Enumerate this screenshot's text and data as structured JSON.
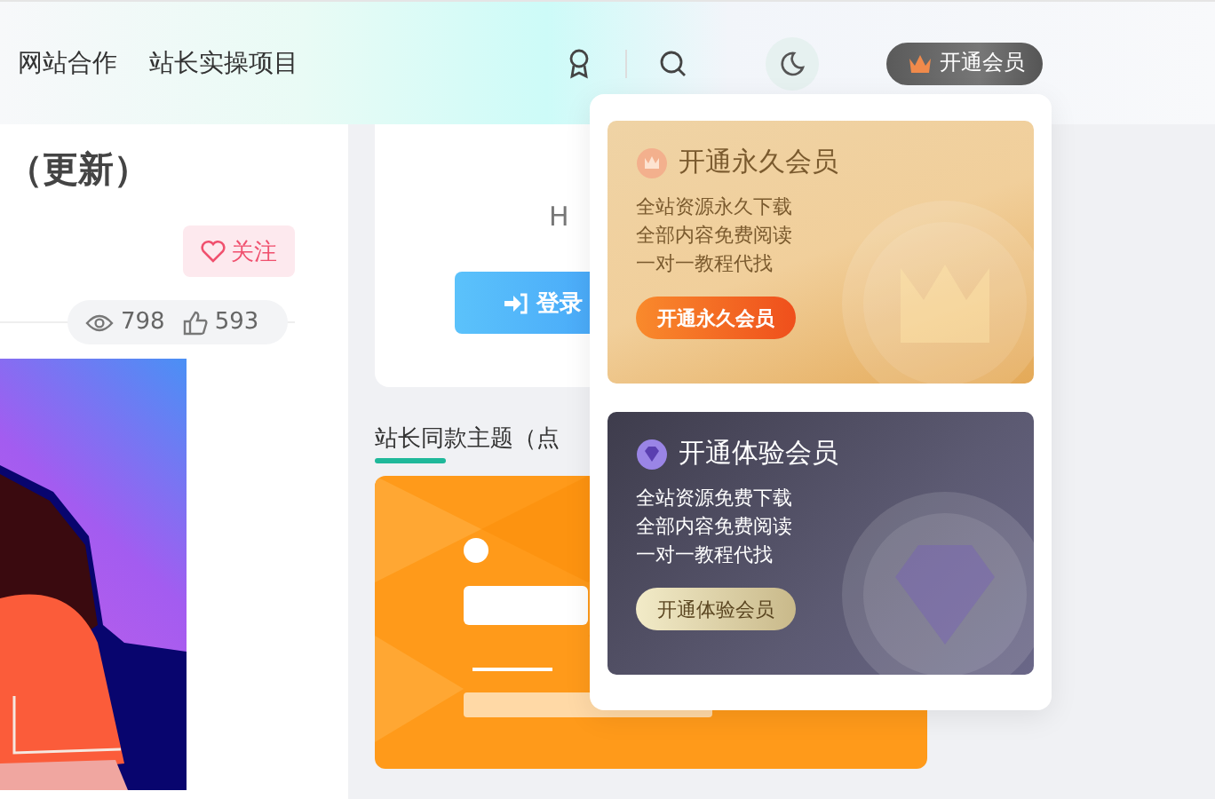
{
  "nav": {
    "items": [
      "网站合作",
      "站长实操项目"
    ],
    "vip_button": "开通会员"
  },
  "post": {
    "title": "（更新）",
    "follow": "关注",
    "views": "798",
    "likes": "593"
  },
  "login_card": {
    "text": "H",
    "button": "登录"
  },
  "section": {
    "title": "站长同款主题（点"
  },
  "vip_menu": [
    {
      "kind": "forever",
      "title": "开通永久会员",
      "perks": [
        "全站资源永久下载",
        "全部内容免费阅读",
        "一对一教程代找"
      ],
      "button": "开通永久会员"
    },
    {
      "kind": "trial",
      "title": "开通体验会员",
      "perks": [
        "全站资源免费下载",
        "全部内容免费阅读",
        "一对一教程代找"
      ],
      "button": "开通体验会员"
    }
  ]
}
